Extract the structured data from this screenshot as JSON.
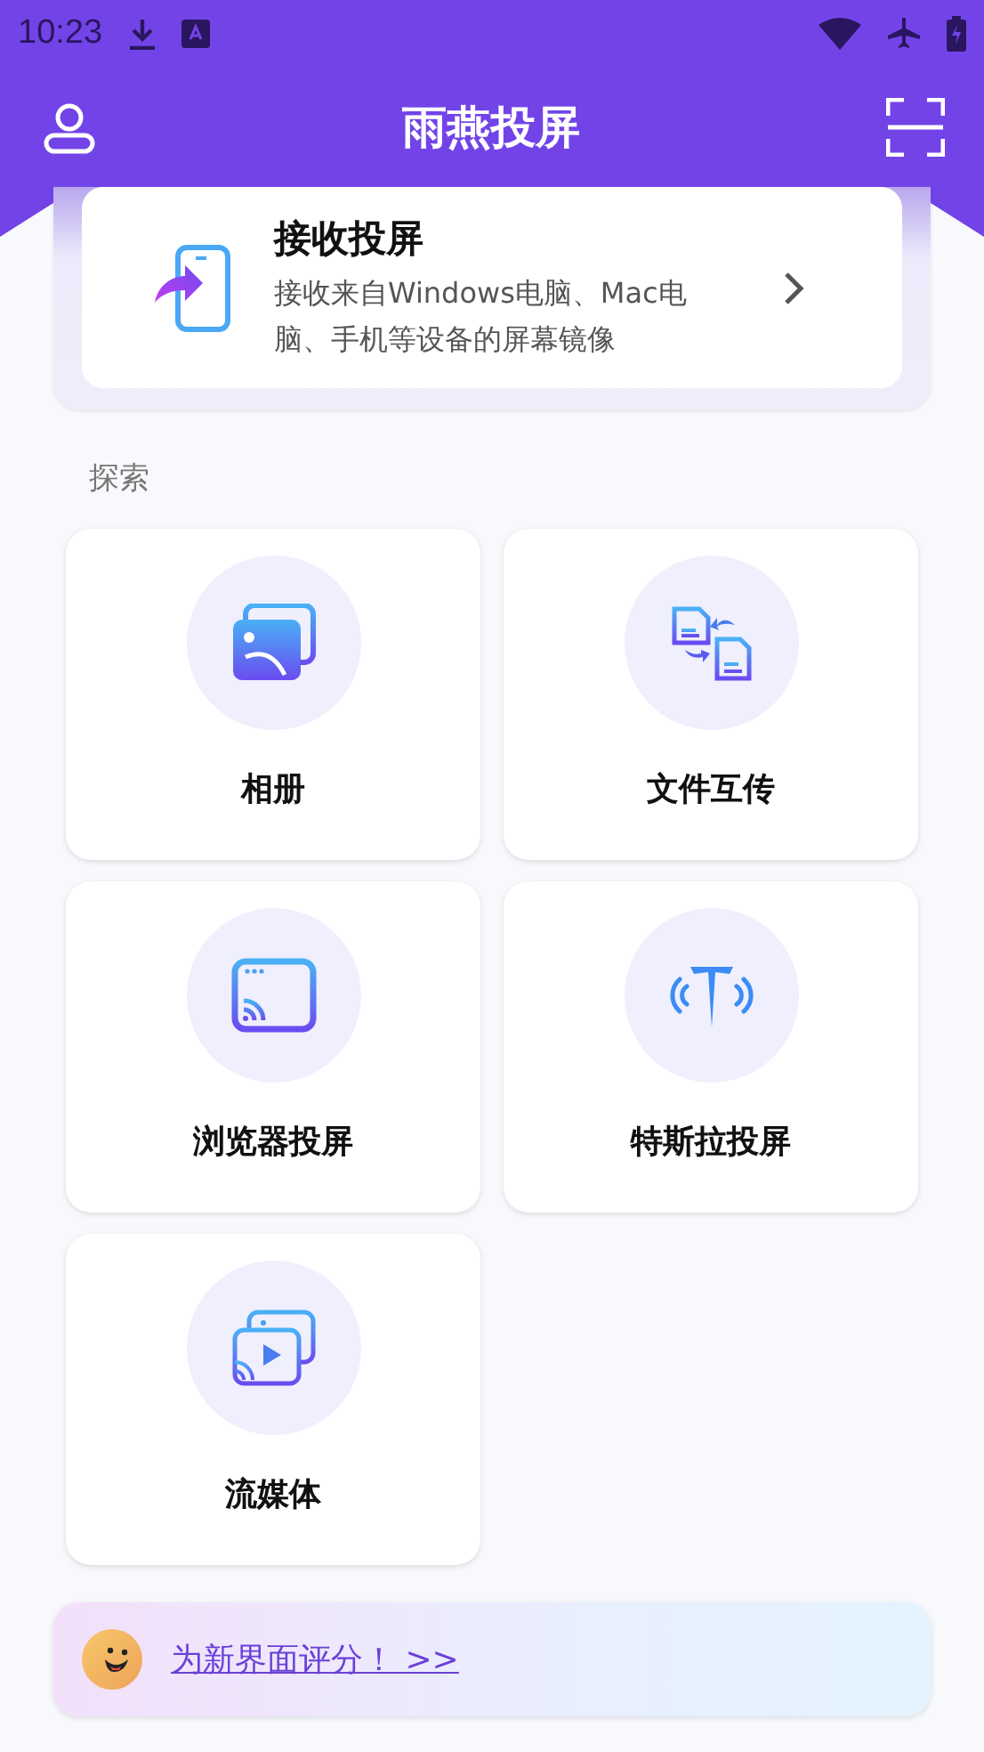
{
  "status_bar": {
    "time": "10:23"
  },
  "app_bar": {
    "title": "雨燕投屏"
  },
  "receive_card": {
    "title": "接收投屏",
    "description": "接收来自Windows电脑、Mac电脑、手机等设备的屏幕镜像"
  },
  "section_title": "探索",
  "tiles": [
    {
      "kind": "album",
      "label": "相册"
    },
    {
      "kind": "file-transfer",
      "label": "文件互传"
    },
    {
      "kind": "browser",
      "label": "浏览器投屏"
    },
    {
      "kind": "tesla",
      "label": "特斯拉投屏"
    },
    {
      "kind": "streaming",
      "label": "流媒体"
    }
  ],
  "rating_banner": {
    "link": "为新界面评分！ >>"
  }
}
